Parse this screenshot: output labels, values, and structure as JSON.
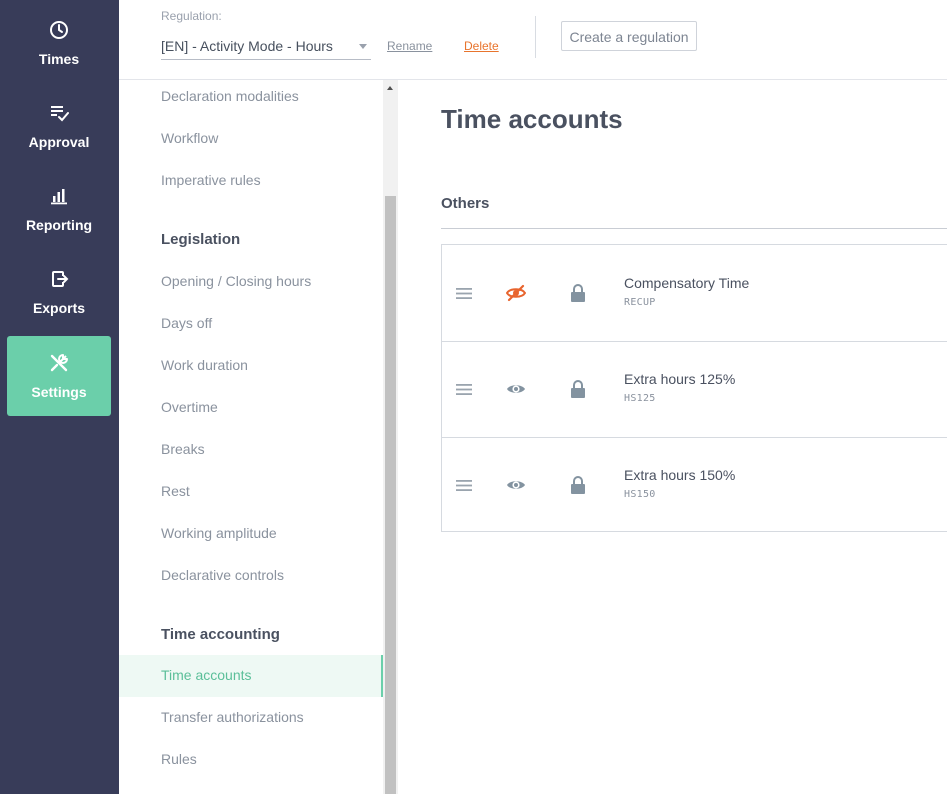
{
  "nav": {
    "items": [
      {
        "label": "Times",
        "icon": "clock-icon"
      },
      {
        "label": "Approval",
        "icon": "checklist-icon"
      },
      {
        "label": "Reporting",
        "icon": "bar-chart-icon"
      },
      {
        "label": "Exports",
        "icon": "export-file-icon"
      },
      {
        "label": "Settings",
        "icon": "tools-icon",
        "active": true
      }
    ]
  },
  "header": {
    "regulation_label": "Regulation:",
    "regulation_value": "[EN] - Activity Mode - Hours",
    "rename_label": "Rename",
    "delete_label": "Delete",
    "create_label": "Create a regulation"
  },
  "sidebar": {
    "top_items": [
      "Declaration modalities",
      "Workflow",
      "Imperative rules"
    ],
    "legislation": {
      "heading": "Legislation",
      "items": [
        "Opening / Closing hours",
        "Days off",
        "Work duration",
        "Overtime",
        "Breaks",
        "Rest",
        "Working amplitude",
        "Declarative controls"
      ]
    },
    "time_accounting": {
      "heading": "Time accounting",
      "items": [
        "Time accounts",
        "Transfer authorizations",
        "Rules"
      ],
      "active": "Time accounts"
    }
  },
  "main": {
    "title": "Time accounts",
    "section": "Others",
    "accounts": [
      {
        "name": "Compensatory Time",
        "code": "RECUP",
        "visibility_icon": "eye-off-icon",
        "visible": false
      },
      {
        "name": "Extra hours 125%",
        "code": "HS125",
        "visibility_icon": "eye-icon",
        "visible": true
      },
      {
        "name": "Extra hours 150%",
        "code": "HS150",
        "visibility_icon": "eye-icon",
        "visible": true
      }
    ]
  },
  "colors": {
    "nav_bg": "#383c59",
    "accent_green": "#6bcfaa",
    "delete_orange": "#e8742d",
    "hidden_icon_orange": "#e8642d",
    "icon_gray": "#8393a0"
  }
}
